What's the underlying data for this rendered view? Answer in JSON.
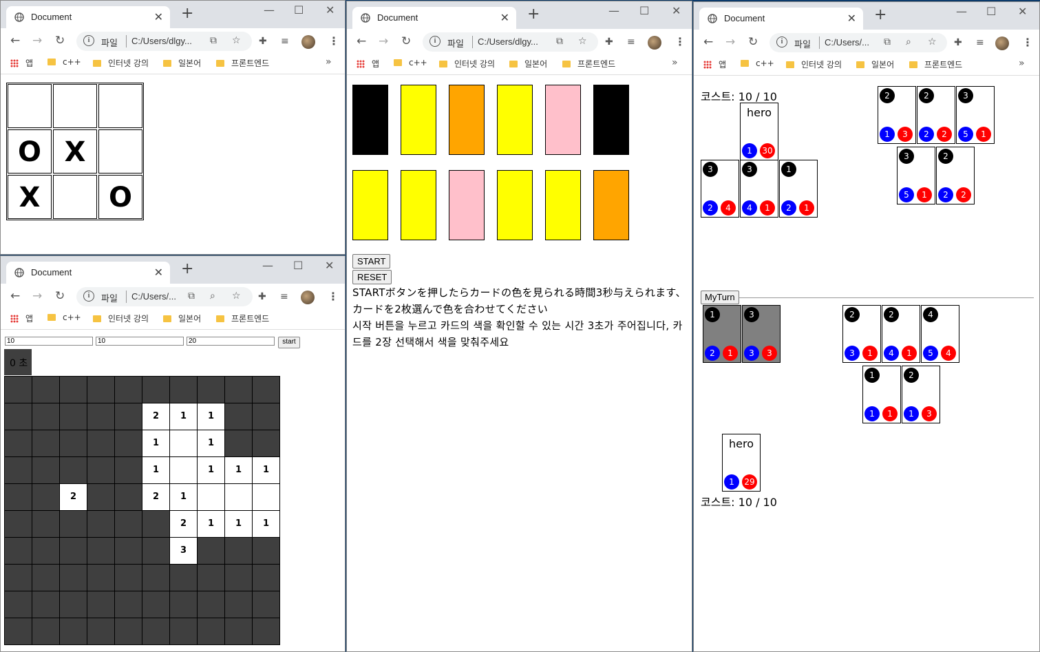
{
  "browser": {
    "tab_title": "Document",
    "file_label": "파일",
    "bookmarks": [
      "앱",
      "c++",
      "인터넷 강의",
      "일본어",
      "프론트엔드"
    ]
  },
  "windows": {
    "tictactoe": {
      "url": "C:/Users/dlgy...",
      "cells": [
        "",
        "",
        "",
        "O",
        "X",
        "",
        "X",
        "",
        "O"
      ]
    },
    "minesweeper": {
      "url": "C:/Users/...",
      "inputs": [
        "10",
        "10",
        "20"
      ],
      "start_label": "start",
      "timer": "0 초",
      "grid": [
        [
          "#",
          "#",
          "#",
          "#",
          "#",
          "#",
          "#",
          "#",
          "#",
          "#"
        ],
        [
          "#",
          "#",
          "#",
          "#",
          "#",
          "2",
          "1",
          "1",
          "#",
          "#"
        ],
        [
          "#",
          "#",
          "#",
          "#",
          "#",
          "1",
          "",
          "1",
          "#",
          "#"
        ],
        [
          "#",
          "#",
          "#",
          "#",
          "#",
          "1",
          "",
          "1",
          "1",
          "1"
        ],
        [
          "#",
          "#",
          "2",
          "#",
          "#",
          "2",
          "1",
          "",
          "",
          ""
        ],
        [
          "#",
          "#",
          "#",
          "#",
          "#",
          "#",
          "2",
          "1",
          "1",
          "1"
        ],
        [
          "#",
          "#",
          "#",
          "#",
          "#",
          "#",
          "3",
          "#",
          "#",
          "#"
        ],
        [
          "#",
          "#",
          "#",
          "#",
          "#",
          "#",
          "#",
          "#",
          "#",
          "#"
        ],
        [
          "#",
          "#",
          "#",
          "#",
          "#",
          "#",
          "#",
          "#",
          "#",
          "#"
        ],
        [
          "#",
          "#",
          "#",
          "#",
          "#",
          "#",
          "#",
          "#",
          "#",
          "#"
        ]
      ]
    },
    "colorgame": {
      "url": "C:/Users/dlgy...",
      "cards": [
        "#000000",
        "#ffff00",
        "#ffa500",
        "#ffff00",
        "#ffc0cb",
        "#000000",
        "#ffff00",
        "#ffff00",
        "#ffc0cb",
        "#ffff00",
        "#ffff00",
        "#ffa500"
      ],
      "start_label": "START",
      "reset_label": "RESET",
      "desc_jp": "STARTボタンを押したらカードの色を見られる時間3秒与えられます、カードを2枚選んで色を合わせてください",
      "desc_kr": "시작 버튼을 누르고 카드의 색을 확인할 수 있는 시간 3초가 주어집니다, 카드를 2장 선택해서 색을 맞춰주세요"
    },
    "cardgame": {
      "url": "C:/Users/...",
      "enemy_cost": "코스트: 10 / 10",
      "my_cost": "코스트: 10 / 10",
      "myturn_label": "MyTurn",
      "enemy_hero": {
        "name": "hero",
        "atk": "1",
        "hp": "30"
      },
      "my_hero": {
        "name": "hero",
        "atk": "1",
        "hp": "29"
      },
      "enemy_field": [
        {
          "cost": "3",
          "atk": "2",
          "hp": "4"
        },
        {
          "cost": "3",
          "atk": "4",
          "hp": "1"
        },
        {
          "cost": "1",
          "atk": "2",
          "hp": "1"
        }
      ],
      "enemy_deck": [
        {
          "cost": "2",
          "atk": "1",
          "hp": "3"
        },
        {
          "cost": "2",
          "atk": "2",
          "hp": "2"
        },
        {
          "cost": "3",
          "atk": "5",
          "hp": "1"
        },
        {
          "cost": "3",
          "atk": "5",
          "hp": "1"
        },
        {
          "cost": "2",
          "atk": "2",
          "hp": "2"
        }
      ],
      "my_field": [
        {
          "cost": "1",
          "atk": "2",
          "hp": "1"
        },
        {
          "cost": "3",
          "atk": "3",
          "hp": "3"
        }
      ],
      "my_deck": [
        {
          "cost": "2",
          "atk": "3",
          "hp": "1"
        },
        {
          "cost": "2",
          "atk": "4",
          "hp": "1"
        },
        {
          "cost": "4",
          "atk": "5",
          "hp": "4"
        },
        {
          "cost": "1",
          "atk": "1",
          "hp": "1"
        },
        {
          "cost": "2",
          "atk": "1",
          "hp": "3"
        }
      ]
    }
  },
  "colors": {
    "tab_bar": "#dee1e6",
    "dark_cell": "#3f3f3f",
    "atk": "#0000ff",
    "hp": "#ff0000",
    "desktop": "#0b3a6b"
  }
}
